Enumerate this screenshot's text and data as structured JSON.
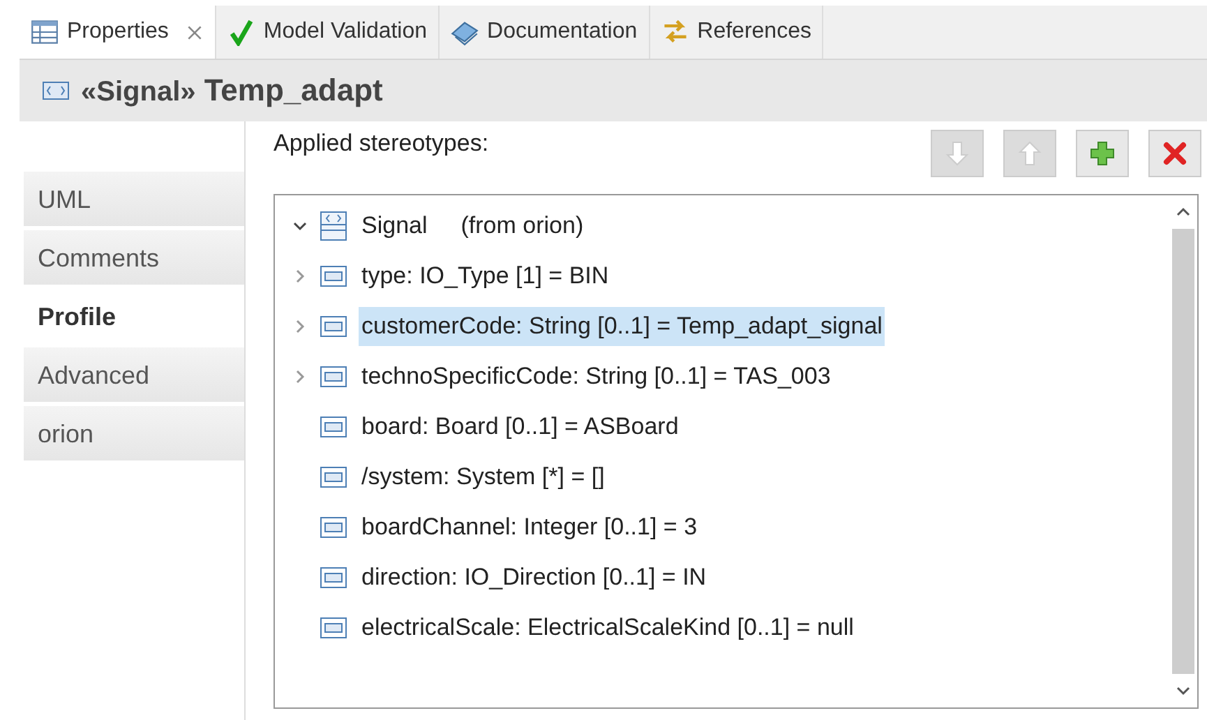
{
  "tabs": [
    {
      "label": "Properties",
      "selected": true,
      "closable": true
    },
    {
      "label": "Model Validation",
      "selected": false,
      "closable": false
    },
    {
      "label": "Documentation",
      "selected": false,
      "closable": false
    },
    {
      "label": "References",
      "selected": false,
      "closable": false
    }
  ],
  "header": {
    "stereotype": "«Signal»",
    "name": "Temp_adapt"
  },
  "sidebar": {
    "items": [
      {
        "label": "UML",
        "selected": false
      },
      {
        "label": "Comments",
        "selected": false
      },
      {
        "label": "Profile",
        "selected": true
      },
      {
        "label": "Advanced",
        "selected": false
      },
      {
        "label": "orion",
        "selected": false
      }
    ]
  },
  "section_label": "Applied stereotypes:",
  "buttons": [
    {
      "kind": "down",
      "disabled": true
    },
    {
      "kind": "up",
      "disabled": true
    },
    {
      "kind": "add",
      "disabled": false
    },
    {
      "kind": "remove",
      "disabled": false
    }
  ],
  "tree": [
    {
      "label": "Signal",
      "note": "(from orion)",
      "expanded": true,
      "selected": false,
      "children": [
        {
          "label": "type: IO_Type [1] = BIN",
          "expandable": true,
          "selected": false
        },
        {
          "label": "customerCode: String [0..1] = Temp_adapt_signal",
          "expandable": true,
          "selected": true
        },
        {
          "label": "technoSpecificCode: String [0..1] = TAS_003",
          "expandable": true,
          "selected": false
        },
        {
          "label": "board: Board [0..1] = ASBoard",
          "expandable": false,
          "selected": false
        },
        {
          "label": "/system: System [*] = []",
          "expandable": false,
          "selected": false
        },
        {
          "label": "boardChannel: Integer [0..1] = 3",
          "expandable": false,
          "selected": false
        },
        {
          "label": "direction: IO_Direction [0..1] = IN",
          "expandable": false,
          "selected": false
        },
        {
          "label": "electricalScale: ElectricalScaleKind [0..1] = null",
          "expandable": false,
          "selected": false
        }
      ]
    }
  ]
}
